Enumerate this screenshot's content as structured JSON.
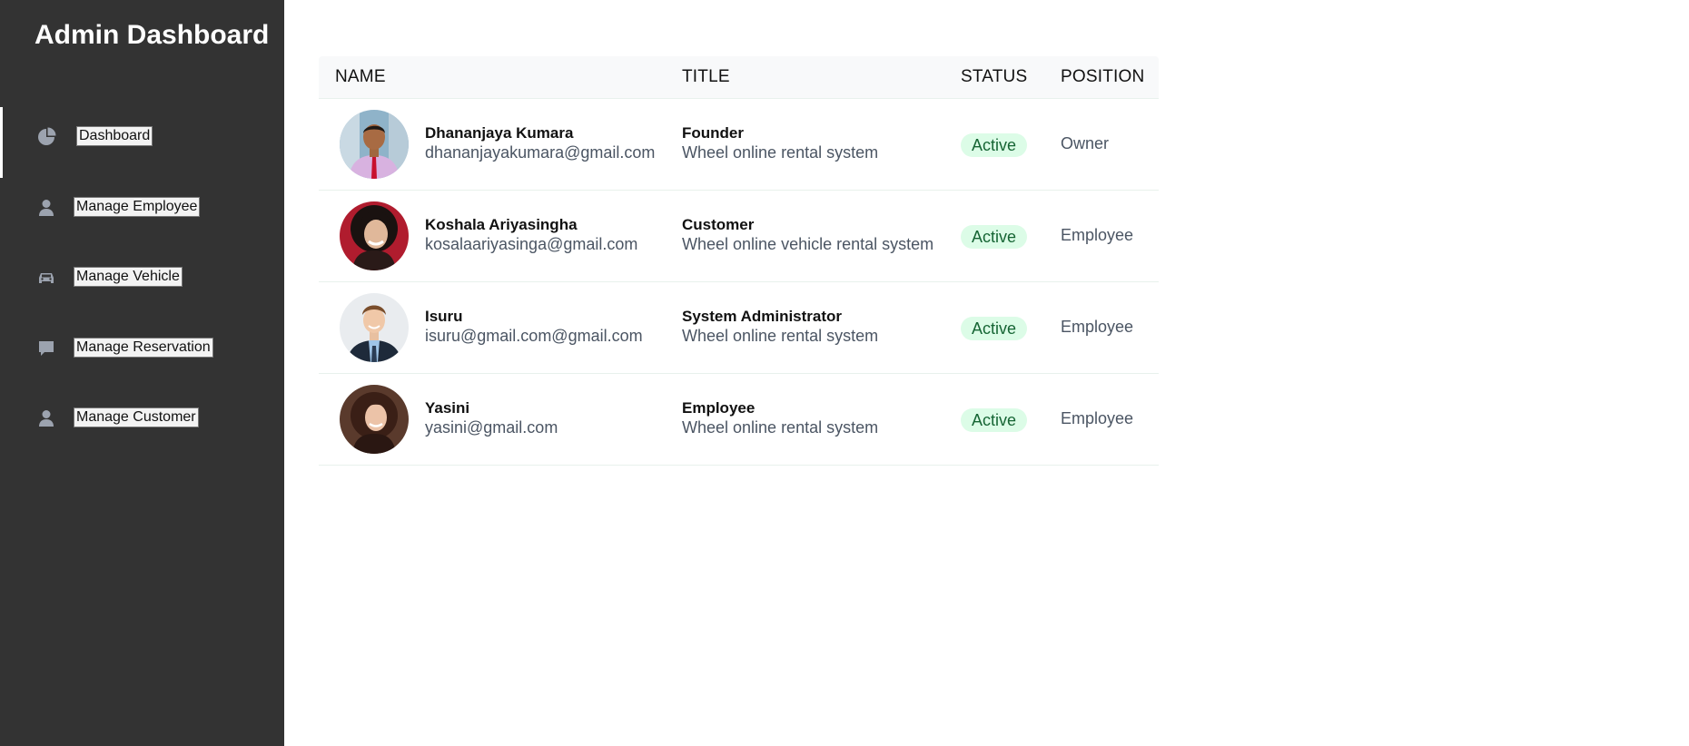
{
  "app": {
    "title": "Admin Dashboard"
  },
  "sidebar": {
    "items": [
      {
        "label": "Dashboard",
        "icon": "pie-chart-icon",
        "active": true
      },
      {
        "label": "Manage Employee",
        "icon": "user-icon"
      },
      {
        "label": "Manage Vehicle",
        "icon": "car-icon"
      },
      {
        "label": "Manage Reservation",
        "icon": "comment-icon"
      },
      {
        "label": "Manage Customer",
        "icon": "user-icon"
      }
    ]
  },
  "table": {
    "headers": [
      "NAME",
      "TITLE",
      "STATUS",
      "POSITION"
    ],
    "rows": [
      {
        "name": "Dhananjaya Kumara",
        "email": "dhananjayakumara@gmail.com",
        "title": "Founder",
        "subtitle": "Wheel online rental system",
        "status": "Active",
        "position": "Owner",
        "avatar": "avatar-man-pink-shirt"
      },
      {
        "name": "Koshala Ariyasingha",
        "email": "kosalaariyasinga@gmail.com",
        "title": "Customer",
        "subtitle": "Wheel online vehicle rental system",
        "status": "Active",
        "position": "Employee",
        "avatar": "avatar-woman-curly-hair"
      },
      {
        "name": "Isuru",
        "email": "isuru@gmail.com@gmail.com",
        "title": "System Administrator",
        "subtitle": "Wheel online rental system",
        "status": "Active",
        "position": "Employee",
        "avatar": "avatar-man-suit"
      },
      {
        "name": "Yasini",
        "email": "yasini@gmail.com",
        "title": "Employee",
        "subtitle": "Wheel online rental system",
        "status": "Active",
        "position": "Employee",
        "avatar": "avatar-woman-dark-hair"
      }
    ]
  },
  "colors": {
    "sidebar_bg": "#333333",
    "badge_bg": "#dcfce7",
    "badge_text": "#166534",
    "header_bg": "#f8f9fa"
  }
}
